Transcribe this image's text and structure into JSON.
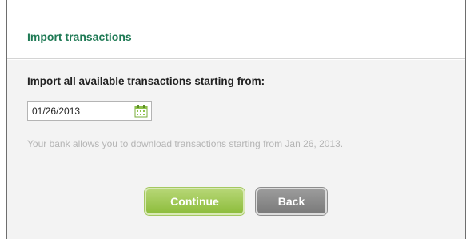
{
  "dialog": {
    "title": "Import transactions"
  },
  "form": {
    "prompt": "Import all available transactions starting from:",
    "date_value": "01/26/2013",
    "calendar_icon": "calendar-icon",
    "note": "Your bank allows you to download transactions starting from Jan 26, 2013."
  },
  "actions": {
    "continue_label": "Continue",
    "back_label": "Back"
  },
  "colors": {
    "title": "#1f7a55",
    "continue_button": "#9cc94f",
    "back_button": "#888888",
    "panel_background": "#f3f3f3"
  }
}
